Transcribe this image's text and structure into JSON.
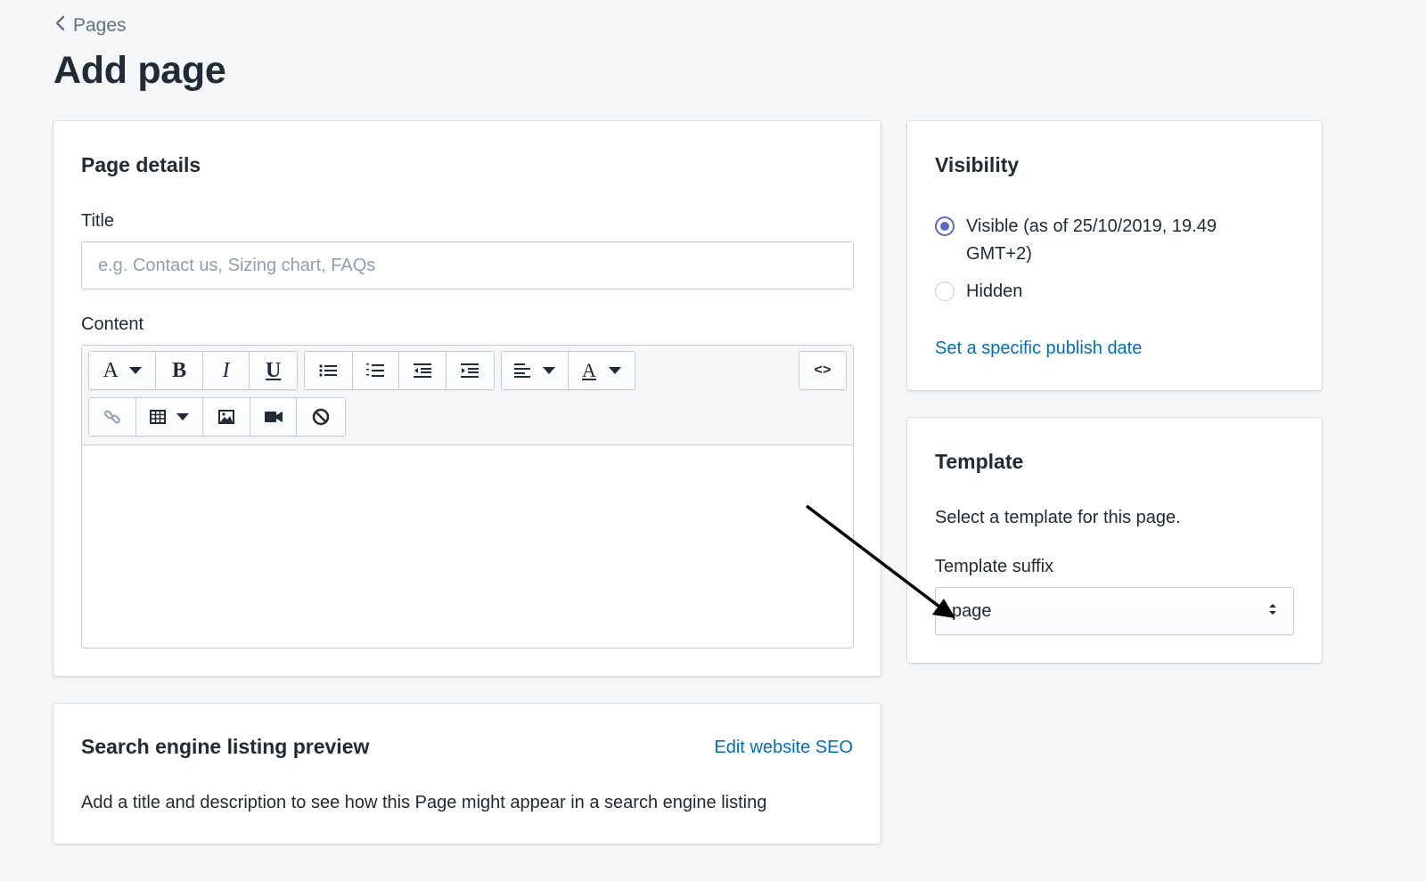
{
  "breadcrumb": {
    "label": "Pages"
  },
  "page_title": "Add page",
  "page_details": {
    "heading": "Page details",
    "title_label": "Title",
    "title_placeholder": "e.g. Contact us, Sizing chart, FAQs",
    "title_value": "",
    "content_label": "Content",
    "toolbar": {
      "row1": [
        "text-style",
        "bold",
        "italic",
        "underline",
        "bulleted-list",
        "numbered-list",
        "outdent",
        "indent",
        "align",
        "text-color",
        "show-html"
      ],
      "row2": [
        "insert-link",
        "insert-table",
        "insert-image",
        "insert-video",
        "clear-formatting"
      ],
      "letters": {
        "text_style": "A",
        "bold": "B",
        "italic": "I",
        "underline": "U",
        "text_color": "A",
        "html": "<>"
      }
    }
  },
  "seo": {
    "heading": "Search engine listing preview",
    "edit_link": "Edit website SEO",
    "description": "Add a title and description to see how this Page might appear in a search engine listing"
  },
  "visibility": {
    "heading": "Visibility",
    "options": [
      {
        "label": "Visible (as of 25/10/2019, 19.49 GMT+2)",
        "checked": true
      },
      {
        "label": "Hidden",
        "checked": false
      }
    ],
    "publish_date_link": "Set a specific publish date"
  },
  "template": {
    "heading": "Template",
    "description": "Select a template for this page.",
    "suffix_label": "Template suffix",
    "suffix_value": "page"
  },
  "colors": {
    "background": "#f4f6f8",
    "link": "#006fbb",
    "radio_accent": "#5c6ac4",
    "text": "#212b36"
  }
}
